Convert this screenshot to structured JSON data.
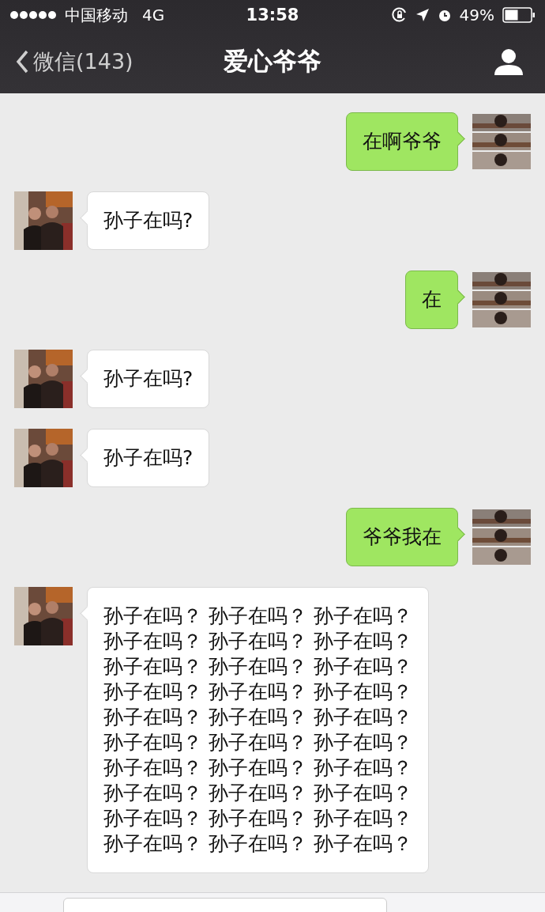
{
  "status_bar": {
    "carrier": "中国移动",
    "network": "4G",
    "time": "13:58",
    "battery": "49%"
  },
  "nav": {
    "back": "微信(143)",
    "title": "爱心爷爷"
  },
  "messages": [
    {
      "kind": "outgoing",
      "lines": [
        "在啊爷爷"
      ]
    },
    {
      "kind": "incoming",
      "lines": [
        "孙子在吗?"
      ]
    },
    {
      "kind": "outgoing",
      "lines": [
        "在"
      ]
    },
    {
      "kind": "incoming",
      "lines": [
        "孙子在吗?"
      ]
    },
    {
      "kind": "incoming",
      "lines": [
        "孙子在吗?"
      ]
    },
    {
      "kind": "outgoing",
      "lines": [
        "爷爷我在"
      ]
    },
    {
      "kind": "incoming",
      "lines": [
        "孙子在吗？ 孙子在吗？ 孙子在吗？",
        "孙子在吗？ 孙子在吗？ 孙子在吗？",
        "孙子在吗？ 孙子在吗？ 孙子在吗？",
        "孙子在吗？ 孙子在吗？ 孙子在吗？",
        "孙子在吗？ 孙子在吗？ 孙子在吗？",
        "孙子在吗？ 孙子在吗？ 孙子在吗？",
        "孙子在吗？ 孙子在吗？ 孙子在吗？",
        "孙子在吗？ 孙子在吗？ 孙子在吗？",
        "孙子在吗？ 孙子在吗？ 孙子在吗？",
        "孙子在吗？ 孙子在吗？ 孙子在吗？"
      ]
    }
  ]
}
